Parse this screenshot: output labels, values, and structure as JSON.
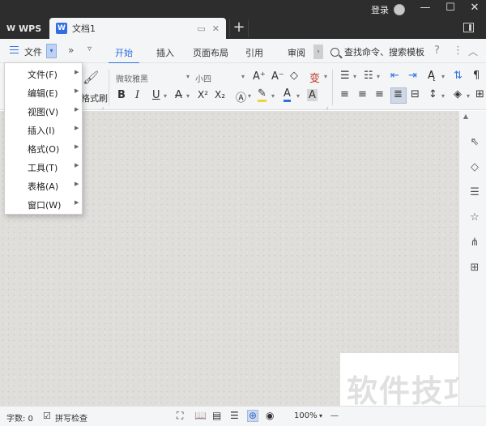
{
  "titlebar": {
    "app_tab": "WPS",
    "doc_tab": "文档1",
    "doc_icon_letter": "W",
    "login": "登录",
    "new_tab": "+",
    "win_min": "—",
    "win_max": "☐",
    "win_close": "✕"
  },
  "menubar": {
    "file": "文件",
    "more": "»",
    "tabs": [
      "开始",
      "插入",
      "页面布局",
      "引用",
      "审阅"
    ],
    "search_placeholder": "查找命令、搜索模板",
    "help": "?",
    "more_menu": "⋮",
    "collapse": "︿"
  },
  "toolbar": {
    "format_painter": "格式刷",
    "font_name": "微软雅黑",
    "font_size": "小四",
    "bold": "B",
    "italic": "I",
    "underline": "U",
    "strikethrough": "A",
    "superscript": "X²",
    "subscript": "X₂",
    "font_color": "A",
    "char_shade": "A",
    "grow_font": "A⁺",
    "shrink_font": "A⁻",
    "clear_format": "◇",
    "phonetic": "变"
  },
  "file_menu": {
    "items": [
      {
        "label": "文件(F)"
      },
      {
        "label": "编辑(E)"
      },
      {
        "label": "视图(V)"
      },
      {
        "label": "插入(I)"
      },
      {
        "label": "格式(O)"
      },
      {
        "label": "工具(T)"
      },
      {
        "label": "表格(A)"
      },
      {
        "label": "窗口(W)"
      }
    ]
  },
  "statusbar": {
    "word_count": "字数: 0",
    "spell_check": "拼写检查",
    "zoom": "100%",
    "zoom_out": "—"
  },
  "watermark": "软件技巧",
  "colors": {
    "accent": "#2f6fe0",
    "titlebar_bg": "#2d2d2d",
    "chrome_bg": "#f4f5f6",
    "canvas_bg": "#dfdedb"
  }
}
